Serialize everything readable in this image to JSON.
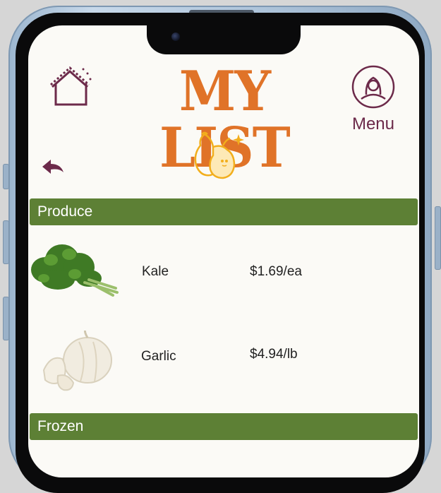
{
  "app": {
    "title": "MY LIST",
    "menu_label": "Menu"
  },
  "icons": {
    "home": "home-icon",
    "menu": "user-profile-icon",
    "logo": "pear-icon",
    "back": "undo-arrow-icon"
  },
  "colors": {
    "title": "#e07328",
    "section_bar": "#5d8035",
    "accent": "#6c2a4a",
    "logo": "#f2ae1c"
  },
  "sections": [
    {
      "label": "Produce",
      "items": [
        {
          "name": "Kale",
          "price": "$1.69/ea",
          "image": "kale-image"
        },
        {
          "name": "Garlic",
          "price": "$4.94/lb",
          "image": "garlic-image"
        }
      ]
    },
    {
      "label": "Frozen",
      "items": []
    }
  ]
}
